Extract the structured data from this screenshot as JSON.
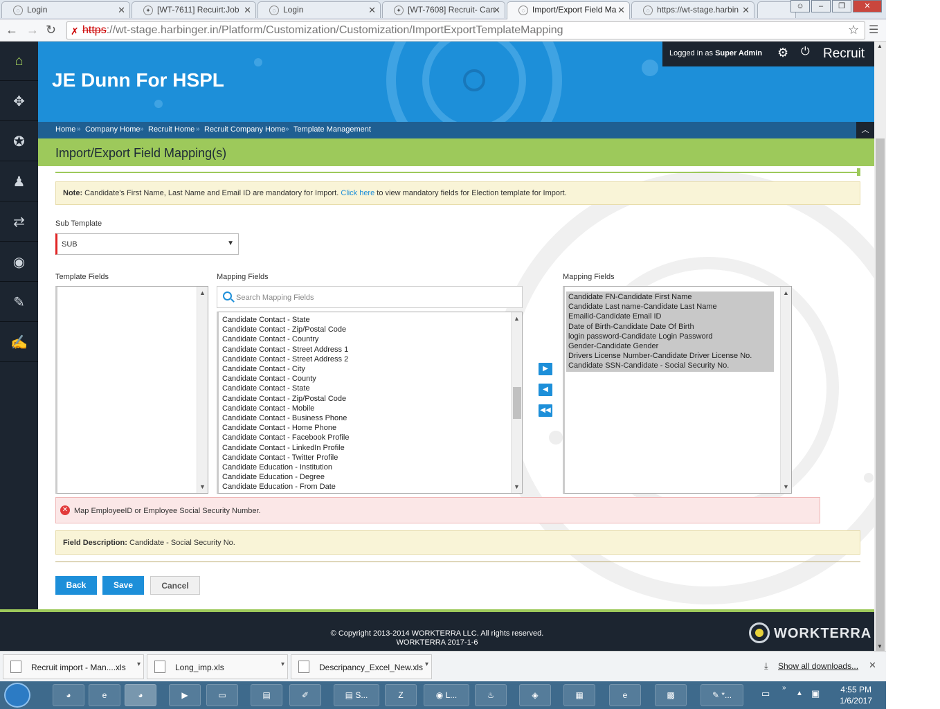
{
  "browser": {
    "tabs": [
      {
        "label": "Login",
        "icon": "globe-icon"
      },
      {
        "label": "[WT-7611] Recuirt:Job",
        "icon": "jira-icon"
      },
      {
        "label": "Login",
        "icon": "globe-icon"
      },
      {
        "label": "[WT-7608] Recruit- Can",
        "icon": "jira-icon"
      },
      {
        "label": "Import/Export Field Ma",
        "icon": "globe-icon",
        "active": true
      },
      {
        "label": "https://wt-stage.harbin",
        "icon": "globe-icon"
      }
    ],
    "url_scheme": "https",
    "url_rest": "://wt-stage.harbinger.in/Platform/Customization/Customization/ImportExportTemplateMapping"
  },
  "app": {
    "company": "JE Dunn For HSPL",
    "logged_prefix": "Logged in as",
    "logged_user": "Super Admin",
    "module": "Recruit"
  },
  "breadcrumb": [
    "Home",
    "Company Home",
    "Recruit Home",
    "Recruit Company Home",
    "Template Management"
  ],
  "page_title": "Import/Export Field Mapping(s)",
  "note": {
    "label": "Note:",
    "text1": "Candidate's First Name, Last Name and Email ID are mandatory for Import.",
    "link": "Click here",
    "text2": "to view mandatory fields for Election template for Import."
  },
  "sub_template": {
    "label": "Sub Template",
    "value": "SUB"
  },
  "template_fields": {
    "label": "Template Fields",
    "items": []
  },
  "mapping_fields": {
    "label": "Mapping Fields",
    "search_placeholder": "Search Mapping Fields",
    "items": [
      "Candidate Contact - State",
      "Candidate Contact - Zip/Postal Code",
      "Candidate Contact - Country",
      "Candidate Contact - Street Address 1",
      "Candidate Contact - Street Address 2",
      "Candidate Contact - City",
      "Candidate Contact - County",
      "Candidate Contact - State",
      "Candidate Contact - Zip/Postal Code",
      "Candidate Contact - Mobile",
      "Candidate Contact - Business Phone",
      "Candidate Contact - Home Phone",
      "Candidate Contact - Facebook Profile",
      "Candidate Contact - LinkedIn Profile",
      "Candidate Contact - Twitter Profile",
      "Candidate Education - Institution",
      "Candidate Education - Degree",
      "Candidate Education - From Date"
    ]
  },
  "mapped_fields": {
    "label": "Mapping Fields",
    "items": [
      "Candidate FN-Candidate First Name",
      "Candidate Last name-Candidate Last Name",
      "Emailid-Candidate Email ID",
      "Date of Birth-Candidate Date Of Birth",
      "login password-Candidate Login Password",
      "Gender-Candidate Gender",
      "Drivers License Number-Candidate Driver License No.",
      "Candidate SSN-Candidate - Social Security No."
    ]
  },
  "error": "Map EmployeeID or Employee Social Security Number.",
  "field_description": {
    "label": "Field Description:",
    "value": "Candidate - Social Security No."
  },
  "buttons": {
    "back": "Back",
    "save": "Save",
    "cancel": "Cancel"
  },
  "footer": {
    "copyright": "© Copyright 2013-2014 WORKTERRA LLC. All rights reserved.",
    "version": "WORKTERRA 2017-1-6",
    "brand": "WORKTERRA"
  },
  "downloads": {
    "items": [
      "Recruit import - Man....xls",
      "Long_imp.xls",
      "Descripancy_Excel_New.xls"
    ],
    "show_all": "Show all downloads..."
  },
  "taskbar": {
    "apps": [
      "S...",
      "L...",
      "*..."
    ],
    "time": "4:55 PM",
    "date": "1/6/2017"
  },
  "colors": {
    "primary": "#1d8fd9",
    "header_bar": "#9dc95b",
    "dark": "#1c2530",
    "error": "#e23a3a"
  }
}
